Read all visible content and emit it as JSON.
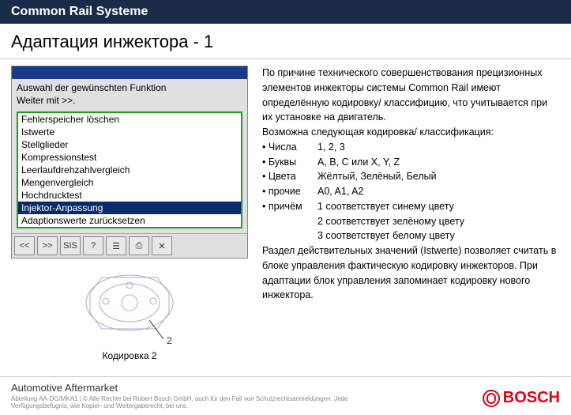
{
  "header": "Common Rail Systeme",
  "subtitle": "Адаптация инжектора - 1",
  "window": {
    "header_line1": "Auswahl der gewünschten Funktion",
    "header_line2": "Weiter mit >>.",
    "items": [
      "Fehlerspeicher löschen",
      "Istwerte",
      "Stellglieder",
      "Kompressionstest",
      "Leerlaufdrehzahlvergleich",
      "Mengenvergleich",
      "Hochdrucktest",
      "Injektor-Anpassung",
      "Adaptionswerte zurücksetzen"
    ],
    "selected_index": 7
  },
  "toolbar_icons": [
    "<<",
    ">>",
    "SIS",
    "?",
    "☰",
    "⎙",
    "✕"
  ],
  "diagram_label": "Кодировка 2",
  "diagram_callout": "2",
  "body": {
    "p1": "По причине технического совершенствования прецизионных элементов инжекторы системы Common Rail имеют определённую кодировку/ классифицию, что учитывается при их установке на двигатель.",
    "p2": "Возможна следующая кодировка/ классификация:",
    "bullets": [
      {
        "k": "• Числа",
        "v": "1, 2, 3"
      },
      {
        "k": "• Буквы",
        "v": "A, B, C или X, Y, Z"
      },
      {
        "k": "• Цвета",
        "v": "Жёлтый, Зелёный, Белый"
      },
      {
        "k": "• прочие",
        "v": "A0, A1, A2"
      },
      {
        "k": "• причём",
        "v": "1 соответствует синему цвету"
      },
      {
        "k": "",
        "v": "2 соответствует зелёному цвету"
      },
      {
        "k": "",
        "v": "3 соответствует белому цвету"
      }
    ],
    "p3": "Раздел действительных значений (Istwerte) позволяет считать в блоке управления фактическую кодировку инжекторов. При адаптации блок управления запоминает кодировку нового инжектора."
  },
  "footer": {
    "brand": "Automotive Aftermarket",
    "copy": "Abteilung AA-DG/MKA1 | © Alle Rechte bei Robert Bosch GmbH, auch für den Fall von Schutzrechtsanmeldungen. Jede Verfügungsbefugnis, wie Kopier- und Weitergaberecht, bei uns.",
    "logo": "BOSCH"
  }
}
